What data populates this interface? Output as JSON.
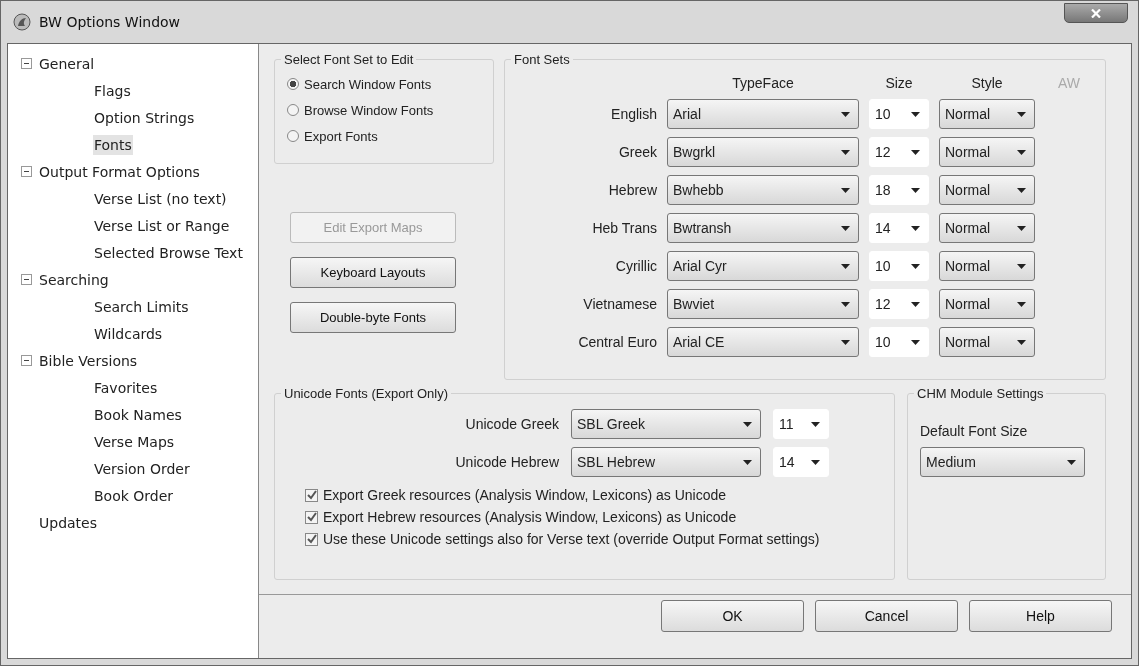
{
  "window": {
    "title": "BW Options Window"
  },
  "tree": [
    {
      "label": "General",
      "selected": false,
      "expanded": true,
      "children": [
        {
          "label": "Flags",
          "selected": false
        },
        {
          "label": "Option Strings",
          "selected": false
        },
        {
          "label": "Fonts",
          "selected": true
        }
      ]
    },
    {
      "label": "Output Format Options",
      "selected": false,
      "expanded": true,
      "children": [
        {
          "label": "Verse List (no text)",
          "selected": false
        },
        {
          "label": "Verse List or Range",
          "selected": false
        },
        {
          "label": "Selected Browse Text",
          "selected": false
        }
      ]
    },
    {
      "label": "Searching",
      "selected": false,
      "expanded": true,
      "children": [
        {
          "label": "Search Limits",
          "selected": false
        },
        {
          "label": "Wildcards",
          "selected": false
        }
      ]
    },
    {
      "label": "Bible Versions",
      "selected": false,
      "expanded": true,
      "children": [
        {
          "label": "Favorites",
          "selected": false
        },
        {
          "label": "Book Names",
          "selected": false
        },
        {
          "label": "Verse Maps",
          "selected": false
        },
        {
          "label": "Version Order",
          "selected": false
        },
        {
          "label": "Book Order",
          "selected": false
        }
      ]
    },
    {
      "label": "Updates",
      "selected": false
    }
  ],
  "font_set_select": {
    "title": "Select Font Set to Edit",
    "options": [
      {
        "label": "Search Window Fonts",
        "selected": true
      },
      {
        "label": "Browse Window Fonts",
        "selected": false
      },
      {
        "label": "Export Fonts",
        "selected": false
      }
    ]
  },
  "buttons": [
    {
      "label": "Edit Export Maps",
      "disabled": true
    },
    {
      "label": "Keyboard Layouts",
      "disabled": false
    },
    {
      "label": "Double-byte Fonts",
      "disabled": false
    }
  ],
  "font_sets": {
    "title": "Font Sets",
    "columns": [
      {
        "label": "TypeFace",
        "disabled": false
      },
      {
        "label": "Size",
        "disabled": false
      },
      {
        "label": "Style",
        "disabled": false
      },
      {
        "label": "AW",
        "disabled": true
      }
    ],
    "rows": [
      {
        "label": "English",
        "typeface": "Arial",
        "size": "10",
        "style": "Normal"
      },
      {
        "label": "Greek",
        "typeface": "Bwgrkl",
        "size": "12",
        "style": "Normal"
      },
      {
        "label": "Hebrew",
        "typeface": "Bwhebb",
        "size": "18",
        "style": "Normal"
      },
      {
        "label": "Heb Trans",
        "typeface": "Bwtransh",
        "size": "14",
        "style": "Normal"
      },
      {
        "label": "Cyrillic",
        "typeface": "Arial Cyr",
        "size": "10",
        "style": "Normal"
      },
      {
        "label": "Vietnamese",
        "typeface": "Bwviet",
        "size": "12",
        "style": "Normal"
      },
      {
        "label": "Central Euro",
        "typeface": "Arial CE",
        "size": "10",
        "style": "Normal"
      }
    ]
  },
  "unicode_fonts": {
    "title": "Unicode Fonts (Export Only)",
    "rows": [
      {
        "label": "Unicode Greek",
        "typeface": "SBL Greek",
        "size": "11"
      },
      {
        "label": "Unicode Hebrew",
        "typeface": "SBL Hebrew",
        "size": "14"
      }
    ],
    "checkboxes": [
      {
        "label": "Export Greek resources (Analysis Window, Lexicons) as Unicode",
        "checked": true
      },
      {
        "label": "Export Hebrew resources (Analysis Window, Lexicons) as Unicode",
        "checked": true
      },
      {
        "label": "Use these Unicode settings also for Verse text (override Output Format settings)",
        "checked": true
      }
    ]
  },
  "chm_settings": {
    "title": "CHM Module Settings",
    "label": "Default Font Size",
    "value": "Medium"
  },
  "footer_buttons": [
    "OK",
    "Cancel",
    "Help"
  ]
}
